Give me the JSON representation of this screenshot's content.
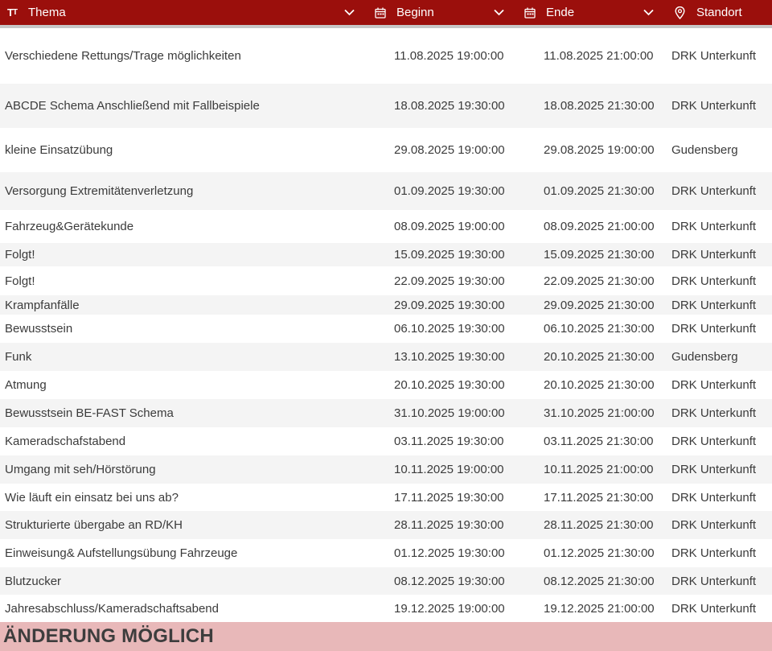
{
  "header": {
    "columns": [
      {
        "label": "Thema",
        "icon": "text-size-icon"
      },
      {
        "label": "Beginn",
        "icon": "calendar-icon"
      },
      {
        "label": "Ende",
        "icon": "calendar-icon"
      },
      {
        "label": "Standort",
        "icon": "location-pin-icon"
      }
    ],
    "color": "#9b0f0c"
  },
  "rows": [
    {
      "thema": "Verschiedene Rettungs/Trage möglichkeiten",
      "beginn": "11.08.2025 19:00:00",
      "ende": "11.08.2025 21:00:00",
      "standort": "DRK Unterkunft"
    },
    {
      "thema": "ABCDE Schema Anschließend mit Fallbeispiele",
      "beginn": "18.08.2025 19:30:00",
      "ende": "18.08.2025 21:30:00",
      "standort": "DRK Unterkunft"
    },
    {
      "thema": "kleine Einsatzübung",
      "beginn": "29.08.2025 19:00:00",
      "ende": "29.08.2025 19:00:00",
      "standort": "Gudensberg"
    },
    {
      "thema": "Versorgung Extremitätenverletzung",
      "beginn": "01.09.2025 19:30:00",
      "ende": "01.09.2025 21:30:00",
      "standort": "DRK Unterkunft"
    },
    {
      "thema": "Fahrzeug&Gerätekunde",
      "beginn": "08.09.2025 19:00:00",
      "ende": "08.09.2025 21:00:00",
      "standort": "DRK Unterkunft"
    },
    {
      "thema": "Folgt!",
      "beginn": "15.09.2025 19:30:00",
      "ende": "15.09.2025 21:30:00",
      "standort": "DRK Unterkunft"
    },
    {
      "thema": "Folgt!",
      "beginn": "22.09.2025 19:30:00",
      "ende": "22.09.2025 21:30:00",
      "standort": "DRK Unterkunft"
    },
    {
      "thema": "Krampfanfälle",
      "beginn": "29.09.2025 19:30:00",
      "ende": "29.09.2025 21:30:00",
      "standort": "DRK Unterkunft"
    },
    {
      "thema": "Bewusstsein",
      "beginn": "06.10.2025 19:30:00",
      "ende": "06.10.2025 21:30:00",
      "standort": "DRK Unterkunft"
    },
    {
      "thema": "Funk",
      "beginn": "13.10.2025 19:30:00",
      "ende": "20.10.2025 21:30:00",
      "standort": "Gudensberg"
    },
    {
      "thema": "Atmung",
      "beginn": "20.10.2025 19:30:00",
      "ende": "20.10.2025 21:30:00",
      "standort": "DRK Unterkunft"
    },
    {
      "thema": "Bewusstsein BE-FAST Schema",
      "beginn": "31.10.2025 19:00:00",
      "ende": "31.10.2025 21:00:00",
      "standort": "DRK Unterkunft"
    },
    {
      "thema": "Kameradschafstabend",
      "beginn": "03.11.2025 19:30:00",
      "ende": "03.11.2025 21:30:00",
      "standort": "DRK Unterkunft"
    },
    {
      "thema": "Umgang mit seh/Hörstörung",
      "beginn": "10.11.2025 19:00:00",
      "ende": "10.11.2025 21:00:00",
      "standort": "DRK Unterkunft"
    },
    {
      "thema": "Wie läuft ein einsatz bei uns ab?",
      "beginn": "17.11.2025 19:30:00",
      "ende": "17.11.2025 21:30:00",
      "standort": "DRK Unterkunft"
    },
    {
      "thema": "Strukturierte übergabe an RD/KH",
      "beginn": "28.11.2025 19:30:00",
      "ende": "28.11.2025 21:30:00",
      "standort": "DRK Unterkunft"
    },
    {
      "thema": "Einweisung& Aufstellungsübung Fahrzeuge",
      "beginn": "01.12.2025 19:30:00",
      "ende": "01.12.2025 21:30:00",
      "standort": "DRK Unterkunft"
    },
    {
      "thema": "Blutzucker",
      "beginn": "08.12.2025 19:30:00",
      "ende": "08.12.2025 21:30:00",
      "standort": "DRK Unterkunft"
    },
    {
      "thema": "Jahresabschluss/Kameradschaftsabend",
      "beginn": "19.12.2025 19:00:00",
      "ende": "19.12.2025 21:00:00",
      "standort": "DRK Unterkunft"
    }
  ],
  "footer": {
    "text": "ÄNDERUNG MÖGLICH",
    "background": "#e8b8b9"
  }
}
